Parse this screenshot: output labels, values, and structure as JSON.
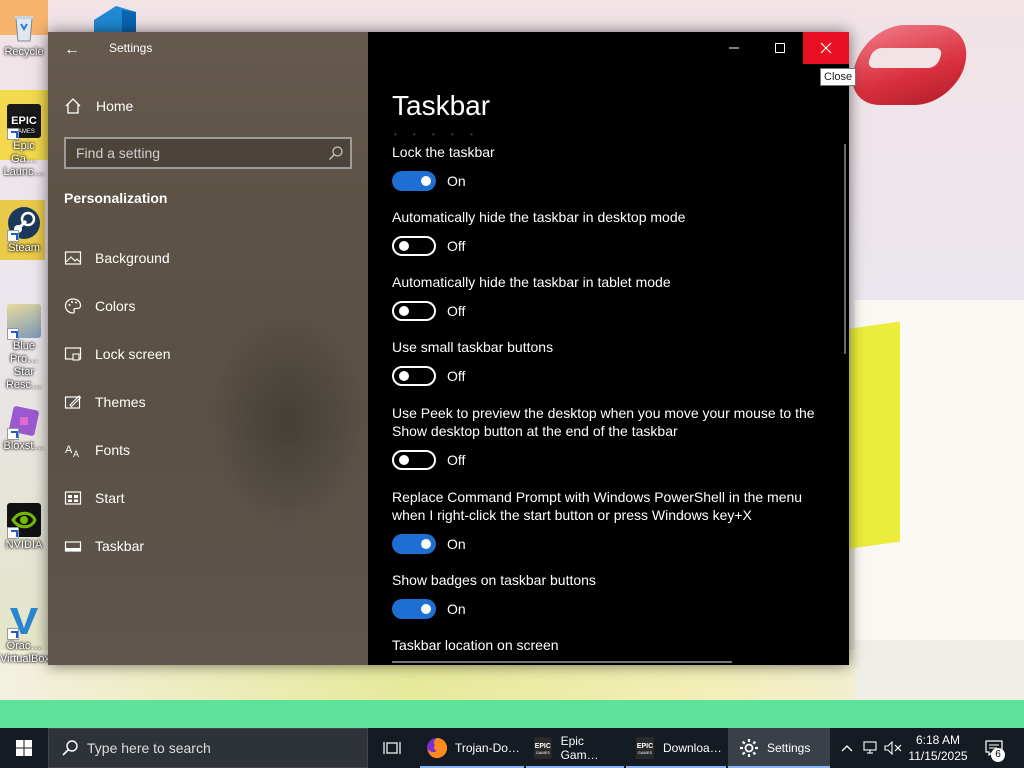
{
  "desktop": {
    "icons": [
      {
        "label": "Recycle",
        "icon": "recycle-bin-icon"
      },
      {
        "label": "Epic Ga… Launc…",
        "icon": "epic-games-icon"
      },
      {
        "label": "Steam",
        "icon": "steam-icon"
      },
      {
        "label": "Blue Pro… Star Resc…",
        "icon": "blue-protocol-icon"
      },
      {
        "label": "Bloxst…",
        "icon": "bloxstrap-icon"
      },
      {
        "label": "NVIDIA",
        "icon": "nvidia-icon"
      },
      {
        "label": "Orac… VirtualBox",
        "icon": "virtualbox-icon"
      }
    ]
  },
  "window": {
    "title": "Settings",
    "back_icon": "back-arrow-icon",
    "close_tooltip": "Close"
  },
  "sidebar": {
    "home_label": "Home",
    "search_placeholder": "Find a setting",
    "section": "Personalization",
    "items": [
      {
        "label": "Background",
        "icon": "background-icon"
      },
      {
        "label": "Colors",
        "icon": "palette-icon"
      },
      {
        "label": "Lock screen",
        "icon": "lock-screen-icon"
      },
      {
        "label": "Themes",
        "icon": "themes-icon"
      },
      {
        "label": "Fonts",
        "icon": "fonts-icon"
      },
      {
        "label": "Start",
        "icon": "start-icon"
      },
      {
        "label": "Taskbar",
        "icon": "taskbar-icon"
      }
    ]
  },
  "content": {
    "heading": "Taskbar",
    "settings": [
      {
        "label": "Lock the taskbar",
        "state": "On",
        "on": true
      },
      {
        "label": "Automatically hide the taskbar in desktop mode",
        "state": "Off",
        "on": false
      },
      {
        "label": "Automatically hide the taskbar in tablet mode",
        "state": "Off",
        "on": false
      },
      {
        "label": "Use small taskbar buttons",
        "state": "Off",
        "on": false
      },
      {
        "label": "Use Peek to preview the desktop when you move your mouse to the Show desktop button at the end of the taskbar",
        "state": "Off",
        "on": false
      },
      {
        "label": "Replace Command Prompt with Windows PowerShell in the menu when I right-click the start button or press Windows key+X",
        "state": "On",
        "on": true
      },
      {
        "label": "Show badges on taskbar buttons",
        "state": "On",
        "on": true
      }
    ],
    "location_label": "Taskbar location on screen"
  },
  "taskbar": {
    "search_placeholder": "Type here to search",
    "apps": [
      {
        "label": "Trojan-Do…",
        "icon": "firefox-icon"
      },
      {
        "label": "Epic Gam…",
        "icon": "epic-games-icon"
      },
      {
        "label": "Downloa…",
        "icon": "epic-games-icon"
      },
      {
        "label": "Settings",
        "icon": "gear-icon",
        "active": true
      }
    ],
    "time": "6:18 AM",
    "date": "11/15/2025",
    "notification_count": "6"
  },
  "colors": {
    "accent": "#1f6ed4",
    "close": "#e81123"
  }
}
